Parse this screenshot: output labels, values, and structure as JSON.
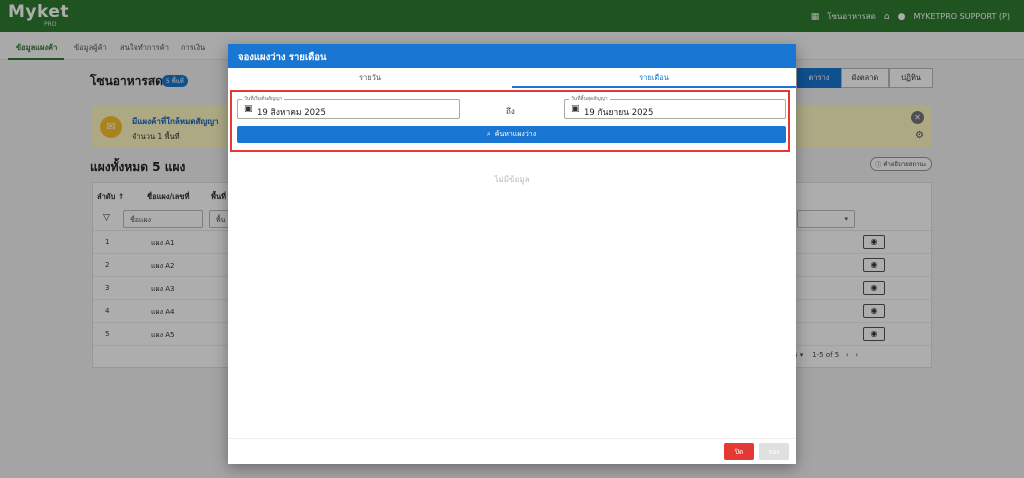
{
  "app": {
    "logo": "Myket",
    "logo_sub": "PRO",
    "venue": "โซนอาหารสด",
    "user": "MYKETPRO SUPPORT (P)",
    "store_icon": "store-icon",
    "home_icon": "home-icon",
    "user_icon": "person-icon"
  },
  "subnav": {
    "tabs": [
      "ข้อมูลแผงค้า",
      "ข้อมูลผู้ค้า",
      "สนใจทำการค้า",
      "การเงิน"
    ]
  },
  "page": {
    "title": "โซนอาหารสด",
    "badge": "5 พื้นที่",
    "views": [
      "ตาราง",
      "ผังตลาด",
      "ปฏิทิน"
    ]
  },
  "banner": {
    "title": "มีแผงค้าที่ใกล้หมดสัญญา",
    "subtitle": "จำนวน 1 พื้นที่",
    "icon": "megaphone-icon"
  },
  "stalls": {
    "title": "แผงทั้งหมด 5 แผง",
    "meaning_button": "คำอธิบายสถานะ",
    "headers": {
      "order": "ลำดับ ↑",
      "name": "ชื่อแผง/เลขที่",
      "area": "พื้นที่"
    },
    "filters": {
      "name": "ชื่อแผง",
      "area": "พื้น"
    },
    "rows": [
      {
        "no": "1",
        "name": "แผง A1"
      },
      {
        "no": "2",
        "name": "แผง A2"
      },
      {
        "no": "3",
        "name": "แผง A3"
      },
      {
        "no": "4",
        "name": "แผง A4"
      },
      {
        "no": "5",
        "name": "แผง A5"
      }
    ],
    "pager": {
      "rows_per_page": "5",
      "range": "1-5 of 5"
    }
  },
  "modal": {
    "title": "จองแผงว่าง รายเดือน",
    "tabs": [
      "รายวัน",
      "รายเดือน"
    ],
    "start_label": "วันที่เริ่มต้นสัญญา",
    "start_value": "19 สิงหาคม 2025",
    "to_label": "ถึง",
    "end_label": "วันที่สิ้นสุดสัญญา",
    "end_value": "19 กันยายน 2025",
    "search_button": "ค้นหาแผงว่าง",
    "no_data": "ไม่มีข้อมูล",
    "close_button": "ปิด",
    "book_button": "จอง"
  },
  "colors": {
    "brand_green": "#2e7d32",
    "primary_blue": "#1976d2",
    "danger_red": "#e53935",
    "warning_yellow": "#fff9c4"
  }
}
